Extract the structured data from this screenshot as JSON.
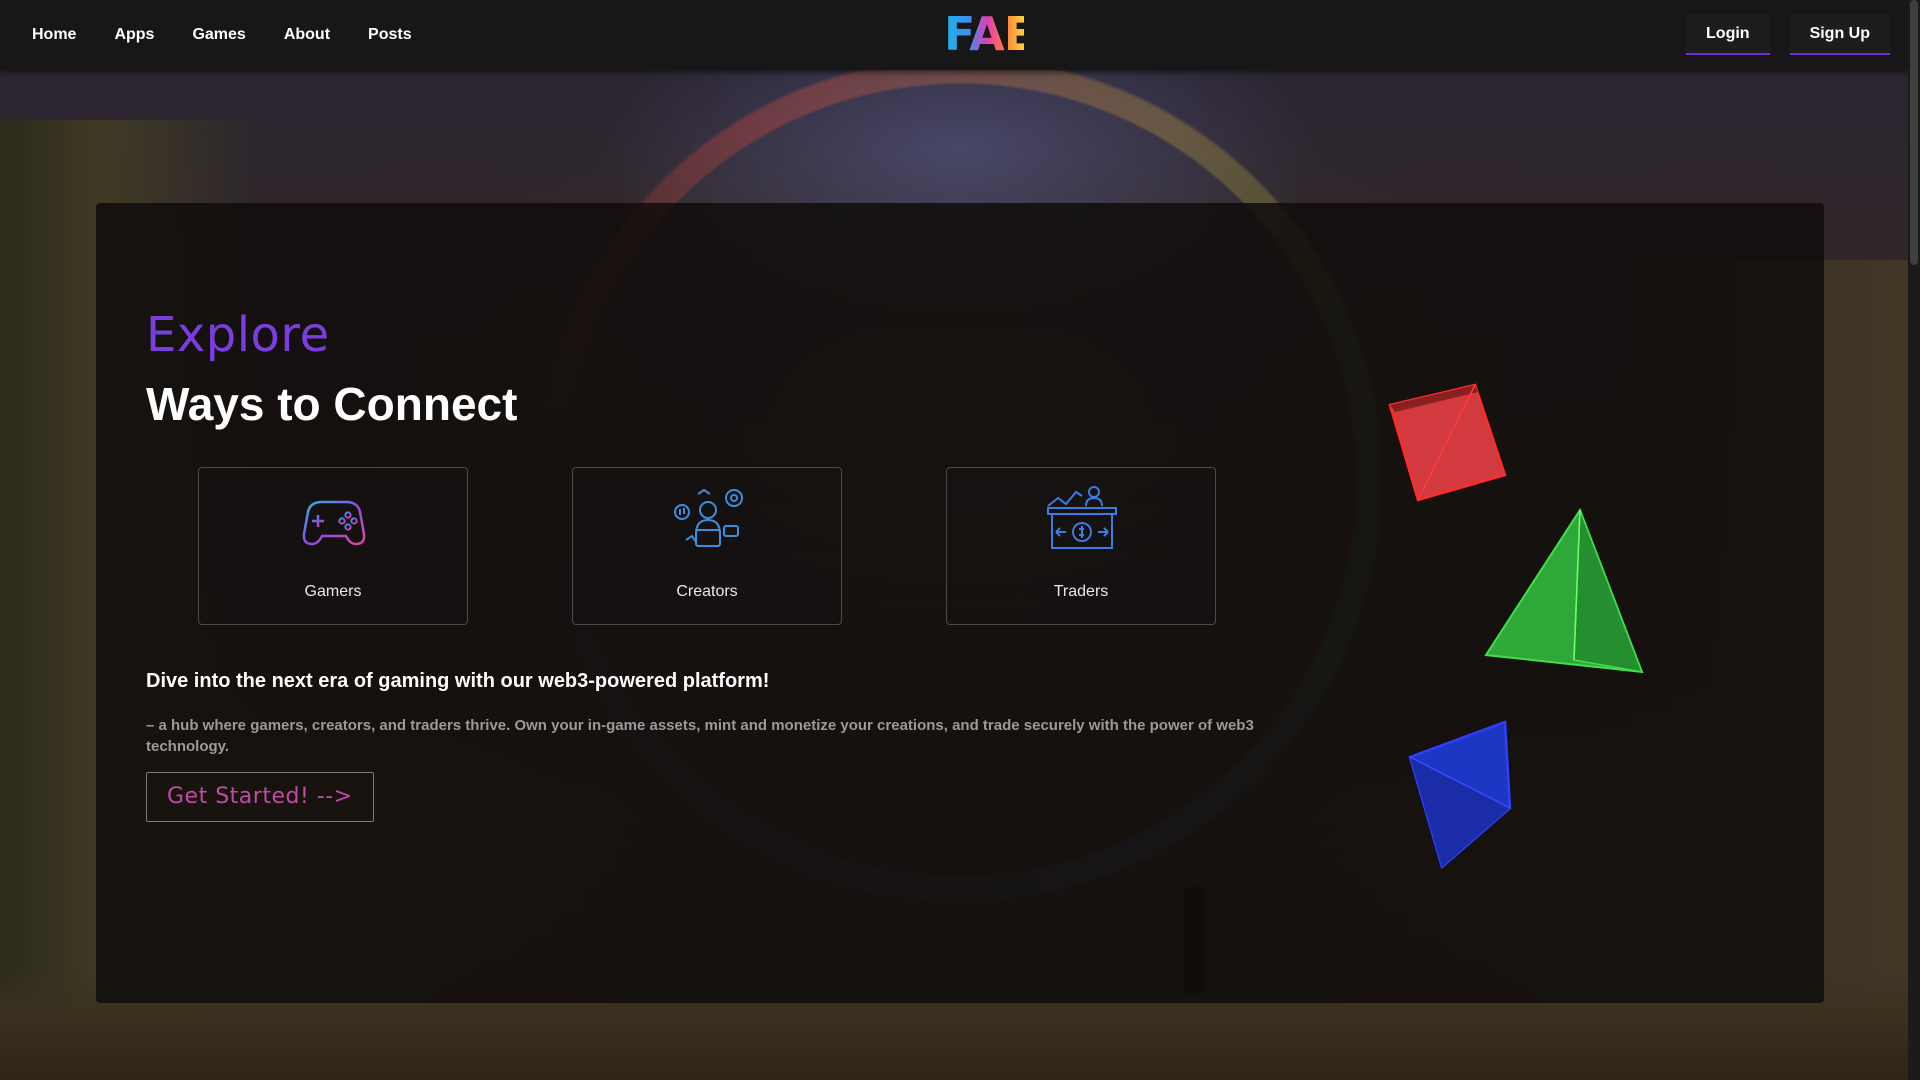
{
  "header": {
    "nav": [
      "Home",
      "Apps",
      "Games",
      "About",
      "Posts"
    ],
    "logo": "FAE",
    "login": "Login",
    "signup": "Sign Up"
  },
  "hero": {
    "eyebrow": "Explore",
    "title": "Ways to Connect",
    "cards": [
      {
        "label": "Gamers",
        "icon": "gamepad-icon"
      },
      {
        "label": "Creators",
        "icon": "creators-icon"
      },
      {
        "label": "Traders",
        "icon": "traders-icon"
      }
    ],
    "lead": "Dive into the next era of gaming with our web3-powered platform!",
    "description": "– a hub where gamers, creators, and traders thrive. Own your in-game assets, mint and monetize your creations, and trade securely with the power of web3 technology.",
    "cta": "Get Started! -->"
  },
  "colors": {
    "accent": "#7a3ee0",
    "cta_text": "#c24aa6",
    "cube": "#d9363a",
    "pyramid": "#2fae3c",
    "tetra": "#1f35c9"
  }
}
